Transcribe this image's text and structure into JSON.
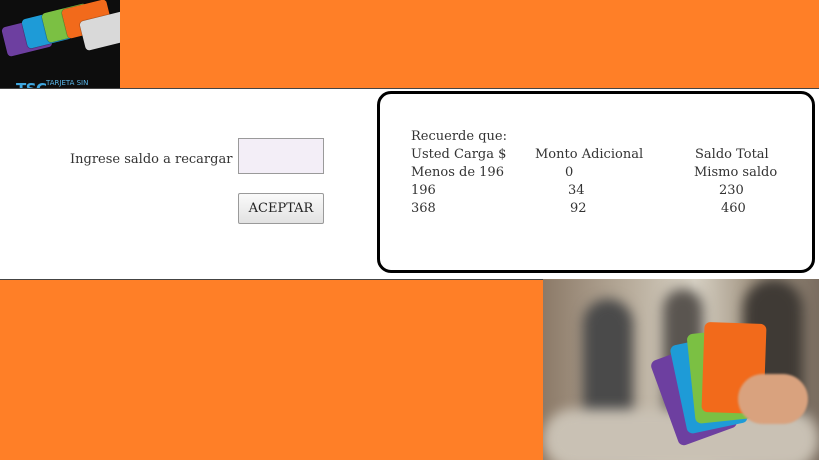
{
  "logo": {
    "brand": "TSC",
    "brand_sub": "TARJETA SIN CONTACTO",
    "card_colors": [
      "#f26a1b",
      "#1e9bd7",
      "#7bc043",
      "#6d3fa0",
      "#d9d9d9"
    ]
  },
  "colors": {
    "background": "#ff7f27",
    "band": "#ffffff"
  },
  "form": {
    "label": "Ingrese saldo a recargar",
    "input_value": "",
    "button_label": "ACEPTAR"
  },
  "info": {
    "intro": "Recuerde que:",
    "headers": [
      "Usted Carga $",
      "Monto Adicional",
      "Saldo Total"
    ],
    "rows": [
      [
        "Menos de 196",
        "0",
        "Mismo saldo"
      ],
      [
        "196",
        "34",
        "230"
      ],
      [
        "368",
        "92",
        "460"
      ]
    ]
  }
}
